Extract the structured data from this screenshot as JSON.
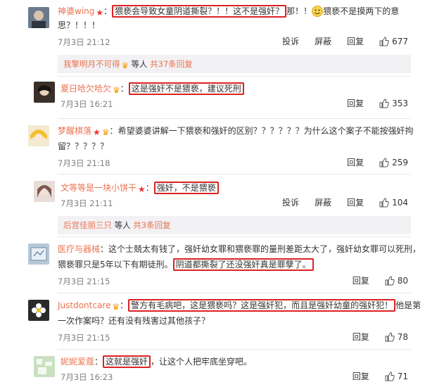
{
  "comments": [
    {
      "nick": "神婆wing",
      "line1_boxed": "猥亵会导致女童阴道撕裂？！！这不是强奸？",
      "line1_rest": "那！！",
      "line1_tail": "猥亵不是摸两下的意",
      "line2": "思？！！！",
      "time": "7月3日 21:12",
      "report": "投诉",
      "block": "屏蔽",
      "reply": "回复",
      "likes": "677",
      "sub_who": "我擎明月不可得",
      "sub_etc": "等人",
      "sub_more": "共37条回复"
    },
    {
      "nick": "夏日哈欠哈欠",
      "line1_boxed": "这是强奸不是猥亵，建议死刑",
      "time": "7月3日 16:21",
      "reply": "回复",
      "likes": "353"
    },
    {
      "nick": "梦醒棋落",
      "line1": "希望婆婆讲解一下猥亵和强奸的区别？？？？？？为什么这个案子不能按强奸拘",
      "line2": "留？？？？？",
      "time": "7月3日 21:18",
      "reply": "回复",
      "likes": "259"
    },
    {
      "nick": "文等等是一块小饼干",
      "line1_boxed": "强奸，不是猥亵",
      "time": "7月3日 21:11",
      "report": "投诉",
      "block": "屏蔽",
      "reply": "回复",
      "likes": "104",
      "sub_who": "后宫佳丽三只",
      "sub_etc": "等人",
      "sub_more": "共3条回复"
    },
    {
      "nick": "医疗与器械",
      "line1": "这个士兢太有钱了，强奸幼女罪和猥亵罪的量刑差距太大了，强奸幼女罪可以死刑，",
      "line2_pre": "猥亵罪只是5年以下有期徒刑。",
      "line2_boxed": "阴道都撕裂了还没强奸真是罪孽了。",
      "time": "7月3日 21:15",
      "reply": "回复",
      "likes": "80"
    },
    {
      "nick": "Justdontcare",
      "line1_boxed": "警方有毛病吧，这是猥亵吗？这是强奸犯，而且是强奸幼童的强奸犯！",
      "line1_tail": "他是第",
      "line2": "一次作案吗？还有没有残害过其他孩子？",
      "time": "7月3日 21:15",
      "reply": "回复",
      "likes": "78"
    },
    {
      "nick": "妮妮爱蔻",
      "line1_boxed": "这就是强奸",
      "line1_tail": "，让这个人把牢底坐穿吧。",
      "time": "7月3日 16:23",
      "reply": "回复",
      "likes": "71"
    }
  ]
}
